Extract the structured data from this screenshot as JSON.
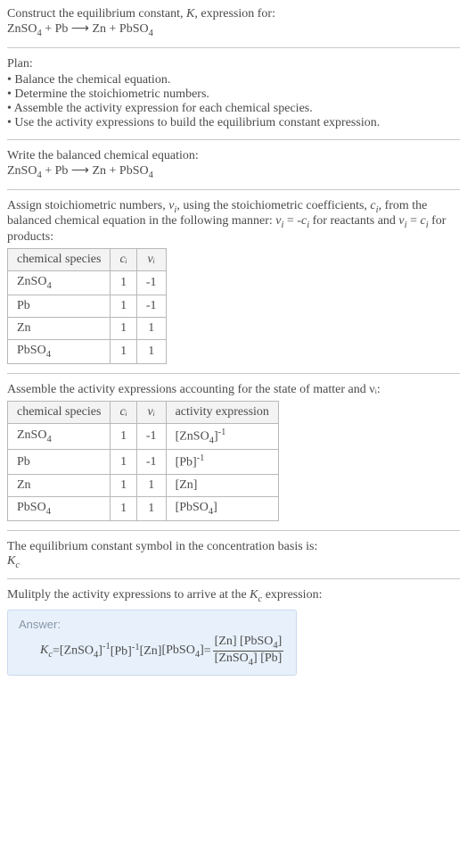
{
  "intro": {
    "line1": "Construct the equilibrium constant, ",
    "K": "K",
    "line1b": ", expression for:",
    "eq_lhs1": "ZnSO",
    "eq_lhs1_sub": "4",
    "plus1": " + Pb ",
    "arrow": "⟶",
    "eq_rhs": " Zn + PbSO",
    "eq_rhs_sub": "4"
  },
  "plan": {
    "header": "Plan:",
    "items": [
      "Balance the chemical equation.",
      "Determine the stoichiometric numbers.",
      "Assemble the activity expression for each chemical species.",
      "Use the activity expressions to build the equilibrium constant expression."
    ]
  },
  "balanced": {
    "header": "Write the balanced chemical equation:",
    "lhs1": "ZnSO",
    "lhs1_sub": "4",
    "plus1": " + Pb ",
    "arrow": "⟶",
    "rhs": " Zn + PbSO",
    "rhs_sub": "4"
  },
  "stoich_text": {
    "a": "Assign stoichiometric numbers, ",
    "nu_i": "ν",
    "i": "i",
    "b": ", using the stoichiometric coefficients, ",
    "c_i": "c",
    "c": ", from the balanced chemical equation in the following manner: ",
    "eq1_l": "ν",
    "eq1_r": " = -",
    "eq1_c": "c",
    "react": " for reactants and ",
    "eq2_l": "ν",
    "eq2_r": " = ",
    "eq2_c": "c",
    "prod": " for products:"
  },
  "table1": {
    "headers": [
      "chemical species",
      "cᵢ",
      "νᵢ"
    ],
    "rows": [
      {
        "sp": "ZnSO",
        "sp_sub": "4",
        "c": "1",
        "nu": "-1"
      },
      {
        "sp": "Pb",
        "sp_sub": "",
        "c": "1",
        "nu": "-1"
      },
      {
        "sp": "Zn",
        "sp_sub": "",
        "c": "1",
        "nu": "1"
      },
      {
        "sp": "PbSO",
        "sp_sub": "4",
        "c": "1",
        "nu": "1"
      }
    ]
  },
  "activity_header": "Assemble the activity expressions accounting for the state of matter and νᵢ:",
  "table2": {
    "headers": [
      "chemical species",
      "cᵢ",
      "νᵢ",
      "activity expression"
    ],
    "rows": [
      {
        "sp": "ZnSO",
        "sp_sub": "4",
        "c": "1",
        "nu": "-1",
        "ae_pre": "[ZnSO",
        "ae_sub": "4",
        "ae_post": "]",
        "ae_sup": "-1"
      },
      {
        "sp": "Pb",
        "sp_sub": "",
        "c": "1",
        "nu": "-1",
        "ae_pre": "[Pb",
        "ae_sub": "",
        "ae_post": "]",
        "ae_sup": "-1"
      },
      {
        "sp": "Zn",
        "sp_sub": "",
        "c": "1",
        "nu": "1",
        "ae_pre": "[Zn",
        "ae_sub": "",
        "ae_post": "]",
        "ae_sup": ""
      },
      {
        "sp": "PbSO",
        "sp_sub": "4",
        "c": "1",
        "nu": "1",
        "ae_pre": "[PbSO",
        "ae_sub": "4",
        "ae_post": "]",
        "ae_sup": ""
      }
    ]
  },
  "conc_basis": {
    "line": "The equilibrium constant symbol in the concentration basis is:",
    "Kc_K": "K",
    "Kc_c": "c"
  },
  "multiply_line": "Mulitply the activity expressions to arrive at the Kc expression:",
  "answer": {
    "label": "Answer:",
    "Kc_K": "K",
    "Kc_c": "c",
    "eq": " = ",
    "t1": "[ZnSO",
    "t1_sub": "4",
    "t1_post": "]",
    "t1_sup": "-1",
    "sp1": " ",
    "t2": "[Pb]",
    "t2_sup": "-1",
    "sp2": " ",
    "t3": "[Zn]",
    "sp3": " ",
    "t4": "[PbSO",
    "t4_sub": "4",
    "t4_post": "]",
    "eq2": " = ",
    "num1": "[Zn] [PbSO",
    "num1_sub": "4",
    "num1_post": "]",
    "den1": "[ZnSO",
    "den1_sub": "4",
    "den1_post": "] [Pb]"
  },
  "chart_data": {
    "type": "table",
    "tables": [
      {
        "title": "Stoichiometric numbers",
        "columns": [
          "chemical species",
          "c_i",
          "nu_i"
        ],
        "rows": [
          [
            "ZnSO4",
            1,
            -1
          ],
          [
            "Pb",
            1,
            -1
          ],
          [
            "Zn",
            1,
            1
          ],
          [
            "PbSO4",
            1,
            1
          ]
        ]
      },
      {
        "title": "Activity expressions",
        "columns": [
          "chemical species",
          "c_i",
          "nu_i",
          "activity expression"
        ],
        "rows": [
          [
            "ZnSO4",
            1,
            -1,
            "[ZnSO4]^-1"
          ],
          [
            "Pb",
            1,
            -1,
            "[Pb]^-1"
          ],
          [
            "Zn",
            1,
            1,
            "[Zn]"
          ],
          [
            "PbSO4",
            1,
            1,
            "[PbSO4]"
          ]
        ]
      }
    ]
  }
}
